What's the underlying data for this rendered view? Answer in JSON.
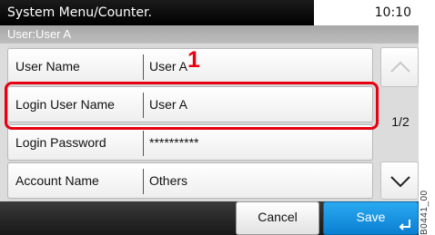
{
  "header": {
    "title": "System Menu/Counter.",
    "clock": "10:10"
  },
  "context_bar": {
    "label": "User:User A"
  },
  "rows": [
    {
      "label": "User Name",
      "value": "User A"
    },
    {
      "label": "Login User Name",
      "value": "User A"
    },
    {
      "label": "Login Password",
      "value": "**********"
    },
    {
      "label": "Account Name",
      "value": "Others"
    }
  ],
  "annotation": {
    "callout_number": "1",
    "highlight_color": "#e60012"
  },
  "pagination": {
    "indicator": "1/2",
    "up_icon": "chevron-up-icon",
    "down_icon": "chevron-down-icon"
  },
  "footer": {
    "cancel_label": "Cancel",
    "save_label": "Save",
    "save_icon": "enter-icon",
    "accent": "#1a96e6"
  },
  "reference_code": "B0441_00"
}
